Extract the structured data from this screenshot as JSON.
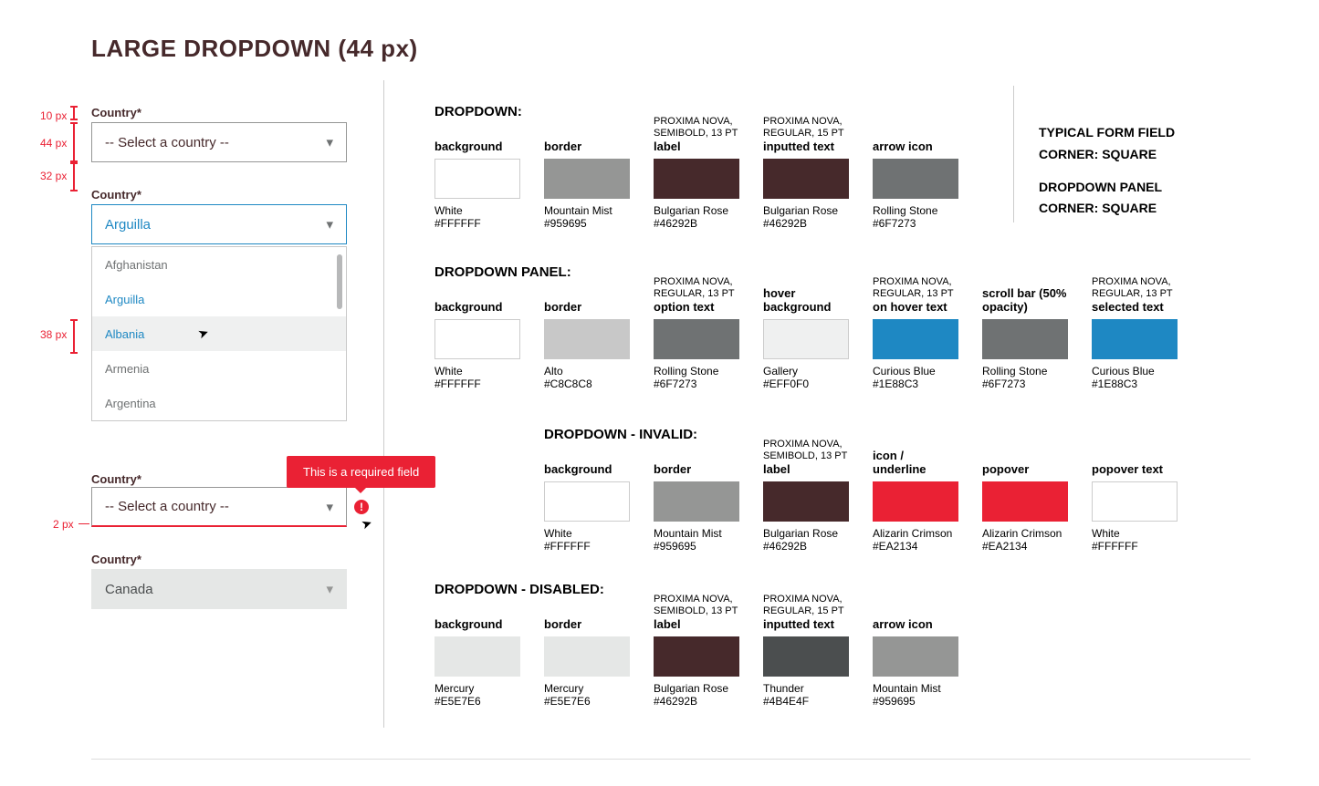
{
  "heading": "LARGE DROPDOWN (44 px)",
  "annotations": {
    "a10": "10 px",
    "a44": "44 px",
    "a32": "32 px",
    "a38": "38 px",
    "a2": "2 px"
  },
  "examples": {
    "label": "Country*",
    "placeholder": "-- Select a country --",
    "active_value": "Arguilla",
    "options": [
      "Afghanistan",
      "Arguilla",
      "Albania",
      "Armenia",
      "Argentina"
    ],
    "error_msg": "This is a required field",
    "disabled_value": "Canada"
  },
  "corner_note": {
    "l1": "TYPICAL FORM FIELD",
    "l2": "CORNER:  SQUARE",
    "l3": "DROPDOWN PANEL",
    "l4": "CORNER:  SQUARE"
  },
  "sections": {
    "s1": {
      "title": "DROPDOWN:",
      "sw": [
        {
          "top": "background",
          "name": "White",
          "hex": "#FFFFFF",
          "color": "#FFFFFF",
          "border": true
        },
        {
          "top": "border",
          "name": "Mountain Mist",
          "hex": "#959695",
          "color": "#959695"
        },
        {
          "top": "label",
          "font": "PROXIMA NOVA, SEMIBOLD, 13 PT",
          "name": "Bulgarian Rose",
          "hex": "#46292B",
          "color": "#46292B"
        },
        {
          "top": "inputted text",
          "font": "PROXIMA NOVA, REGULAR, 15 PT",
          "name": "Bulgarian Rose",
          "hex": "#46292B",
          "color": "#46292B"
        },
        {
          "top": "arrow icon",
          "name": "Rolling Stone",
          "hex": "#6F7273",
          "color": "#6F7273"
        }
      ]
    },
    "s2": {
      "title": "DROPDOWN PANEL:",
      "sw": [
        {
          "top": "background",
          "name": "White",
          "hex": "#FFFFFF",
          "color": "#FFFFFF",
          "border": true
        },
        {
          "top": "border",
          "name": "Alto",
          "hex": "#C8C8C8",
          "color": "#C8C8C8"
        },
        {
          "top": "option text",
          "font": "PROXIMA NOVA, REGULAR, 13 PT",
          "name": "Rolling Stone",
          "hex": "#6F7273",
          "color": "#6F7273"
        },
        {
          "top": "hover background",
          "name": "Gallery",
          "hex": "#EFF0F0",
          "color": "#EFF0F0",
          "border": true
        },
        {
          "top": "on hover text",
          "font": "PROXIMA NOVA, REGULAR, 13 PT",
          "name": "Curious Blue",
          "hex": "#1E88C3",
          "color": "#1E88C3"
        },
        {
          "top": "scroll bar (50% opacity)",
          "name": "Rolling Stone",
          "hex": "#6F7273",
          "color": "#6F7273"
        },
        {
          "top": "selected text",
          "font": "PROXIMA NOVA, REGULAR, 13 PT",
          "name": "Curious Blue",
          "hex": "#1E88C3",
          "color": "#1E88C3"
        }
      ]
    },
    "s3": {
      "title": "DROPDOWN - INVALID:",
      "sw": [
        {
          "top": "background",
          "name": "White",
          "hex": "#FFFFFF",
          "color": "#FFFFFF",
          "border": true
        },
        {
          "top": "border",
          "name": "Mountain Mist",
          "hex": "#959695",
          "color": "#959695"
        },
        {
          "top": "label",
          "font": "PROXIMA NOVA, SEMIBOLD, 13 PT",
          "name": "Bulgarian Rose",
          "hex": "#46292B",
          "color": "#46292B"
        },
        {
          "top": "icon / underline",
          "name": "Alizarin Crimson",
          "hex": "#EA2134",
          "color": "#EA2134"
        },
        {
          "top": "popover",
          "name": "Alizarin Crimson",
          "hex": "#EA2134",
          "color": "#EA2134"
        },
        {
          "top": "popover text",
          "name": "White",
          "hex": "#FFFFFF",
          "color": "#FFFFFF",
          "border": true
        }
      ]
    },
    "s4": {
      "title": "DROPDOWN - DISABLED:",
      "sw": [
        {
          "top": "background",
          "name": "Mercury",
          "hex": "#E5E7E6",
          "color": "#E5E7E6"
        },
        {
          "top": "border",
          "name": "Mercury",
          "hex": "#E5E7E6",
          "color": "#E5E7E6"
        },
        {
          "top": "label",
          "font": "PROXIMA NOVA, SEMIBOLD, 13 PT",
          "name": "Bulgarian Rose",
          "hex": "#46292B",
          "color": "#46292B"
        },
        {
          "top": "inputted text",
          "font": "PROXIMA NOVA, REGULAR, 15 PT",
          "name": "Thunder",
          "hex": "#4B4E4F",
          "color": "#4B4E4F"
        },
        {
          "top": "arrow icon",
          "name": "Mountain Mist",
          "hex": "#959695",
          "color": "#959695"
        }
      ]
    }
  }
}
